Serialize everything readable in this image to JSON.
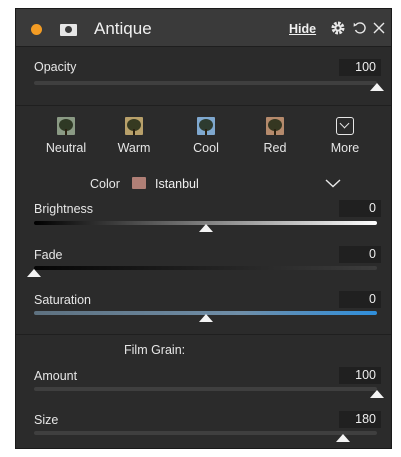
{
  "header": {
    "title": "Antique",
    "hide_label": "Hide",
    "accent_color": "#f39c24"
  },
  "opacity": {
    "label": "Opacity",
    "value": "100",
    "level": 1.0
  },
  "presets": [
    {
      "label": "Neutral",
      "tint": "#8a9a84"
    },
    {
      "label": "Warm",
      "tint": "#b8a06a"
    },
    {
      "label": "Cool",
      "tint": "#7fa8cf"
    },
    {
      "label": "Red",
      "tint": "#b58a6c"
    },
    {
      "label": "More",
      "icon": "chevron-down-box-icon"
    }
  ],
  "color": {
    "label": "Color",
    "selected": "Istanbul",
    "swatch": "#b07f76"
  },
  "sliders": {
    "brightness": {
      "label": "Brightness",
      "value": "0",
      "level": 0.5
    },
    "fade": {
      "label": "Fade",
      "value": "0",
      "level": 0.0
    },
    "saturation": {
      "label": "Saturation",
      "value": "0",
      "level": 0.5
    }
  },
  "film_grain": {
    "heading": "Film Grain:",
    "amount": {
      "label": "Amount",
      "value": "100",
      "level": 1.0
    },
    "size": {
      "label": "Size",
      "value": "180",
      "level": 0.9
    }
  }
}
